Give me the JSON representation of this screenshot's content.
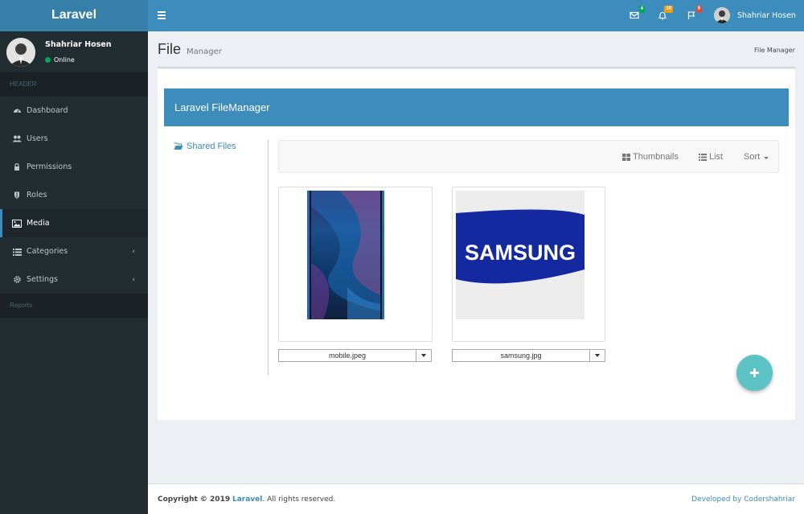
{
  "brand": "Laravel",
  "header": {
    "badges": {
      "messages": "4",
      "notifications": "10",
      "flags": "9"
    },
    "user_name": "Shahriar Hosen"
  },
  "sidebar": {
    "user": {
      "name": "Shahriar Hosen",
      "status": "Online"
    },
    "section_header": "HEADER",
    "items": [
      {
        "label": "Dashboard",
        "icon": "dashboard-icon"
      },
      {
        "label": "Users",
        "icon": "users-icon"
      },
      {
        "label": "Permissions",
        "icon": "lock-icon"
      },
      {
        "label": "Roles",
        "icon": "shield-icon"
      },
      {
        "label": "Media",
        "icon": "image-icon",
        "active": true
      },
      {
        "label": "Categories",
        "icon": "list-icon"
      },
      {
        "label": "Settings",
        "icon": "gear-icon"
      }
    ],
    "reports_header": "Reports"
  },
  "page": {
    "title": "File",
    "subtitle": "Manager",
    "breadcrumb": "File Manager"
  },
  "filemanager": {
    "title": "Laravel FileManager",
    "tree_item": "Shared Files",
    "toolbar": {
      "thumbnails": "Thumbnails",
      "list": "List",
      "sort": "Sort"
    },
    "files": [
      {
        "name": "mobile.jpeg"
      },
      {
        "name": "samsung.jpg"
      }
    ],
    "samsung_logo_text": "SAMSUNG"
  },
  "footer": {
    "copyright_prefix": "Copyright © 2019",
    "copyright_link": "Laravel",
    "copyright_suffix": ". All rights reserved.",
    "developed_by": "Developed by Codershahriar"
  },
  "colors": {
    "primary": "#3c8dbc",
    "sidebar": "#222d32",
    "fab": "#5cc2c4"
  }
}
